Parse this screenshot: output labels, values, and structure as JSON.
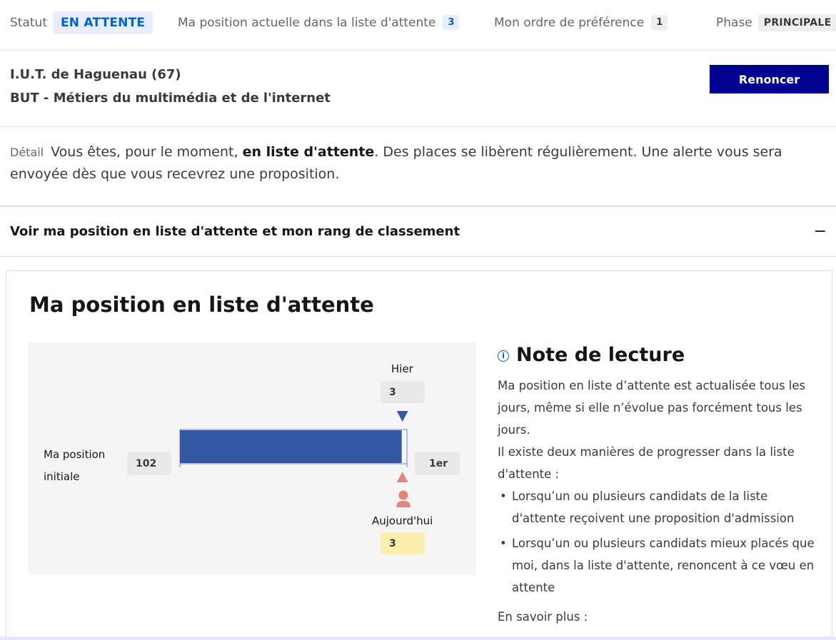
{
  "status": {
    "label": "Statut",
    "value": "EN ATTENTE",
    "position_label": "Ma position actuelle dans la liste d'attente",
    "position_value": "3",
    "preference_label": "Mon ordre de préférence",
    "preference_value": "1",
    "phase_label": "Phase",
    "phase_value": "PRINCIPALE"
  },
  "program": {
    "school": "I.U.T. de Haguenau (67)",
    "formation": "BUT - Métiers du multimédia et de l'internet",
    "renounce_label": "Renoncer"
  },
  "detail": {
    "label": "Détail",
    "text_before": "Vous êtes, pour le moment, ",
    "text_bold": "en liste d'attente",
    "text_after": ". Des places se libèrent régulièrement. Une alerte vous sera envoyée dès que vous recevrez une proposition."
  },
  "accordion": {
    "title": "Voir ma position en liste d'attente et mon rang de classement",
    "toggle": "−"
  },
  "panel": {
    "title": "Ma position en liste d'attente"
  },
  "chart_data": {
    "type": "bar",
    "initial_label_line1": "Ma position",
    "initial_label_line2": "initiale",
    "initial_position": "102",
    "first_label": "1er",
    "yesterday_label": "Hier",
    "yesterday_value": "3",
    "today_label": "Aujourd'hui",
    "today_value": "3",
    "range": [
      102,
      1
    ],
    "yesterday": 3,
    "today": 3,
    "colors": {
      "bar": "#3558a2",
      "yesterday_marker": "#3558a2",
      "today_marker": "#e1877a",
      "today_box": "#fcefae"
    }
  },
  "note": {
    "title": "Note de lecture",
    "para1": "Ma position en liste d’attente est actualisée tous les jours, même si elle n’évolue pas forcément tous les jours.",
    "para2": "Il existe deux manières de progresser dans la liste d'attente :",
    "bullets": [
      "Lorsqu’un ou plusieurs candidats de la liste d'attente reçoivent une proposition d'admission",
      "Lorsqu’un ou plusieurs candidats mieux placés que moi, dans la liste d'attente, renoncent à ce vœu en attente"
    ],
    "more": "En savoir plus :"
  }
}
